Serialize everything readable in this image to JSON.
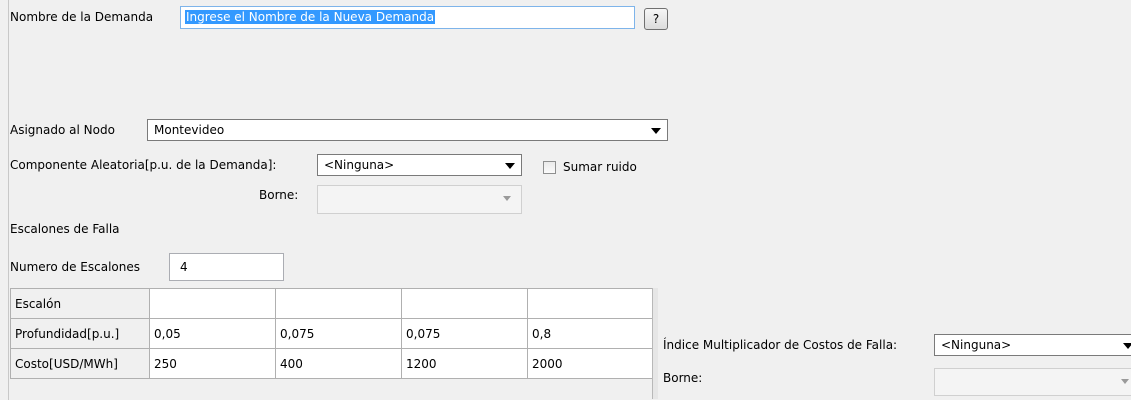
{
  "demand_name": {
    "label": "Nombre de la Demanda",
    "value": "Ingrese el Nombre de la Nueva Demanda",
    "help_label": "?"
  },
  "node": {
    "label": "Asignado al Nodo",
    "selected": "Montevideo"
  },
  "random_component": {
    "label": "Componente Aleatoria[p.u. de la Demanda]:",
    "selected": "<Ninguna>",
    "add_noise_label": "Sumar ruido",
    "add_noise_checked": false,
    "borne_label": "Borne:",
    "borne_value": ""
  },
  "failure_steps": {
    "section_title": "Escalones de Falla",
    "count_label": "Numero de Escalones",
    "count_value": "4",
    "table": {
      "header_label": "Escalón",
      "rows": [
        {
          "label": "Profundidad[p.u.]",
          "values": [
            "0,05",
            "0,075",
            "0,075",
            "0,8"
          ]
        },
        {
          "label": "Costo[USD/MWh]",
          "values": [
            "250",
            "400",
            "1200",
            "2000"
          ]
        }
      ]
    }
  },
  "failure_cost_index": {
    "label": "Índice Multiplicador de Costos de Falla:",
    "selected": "<Ninguna>",
    "borne_label": "Borne:",
    "borne_value": ""
  }
}
